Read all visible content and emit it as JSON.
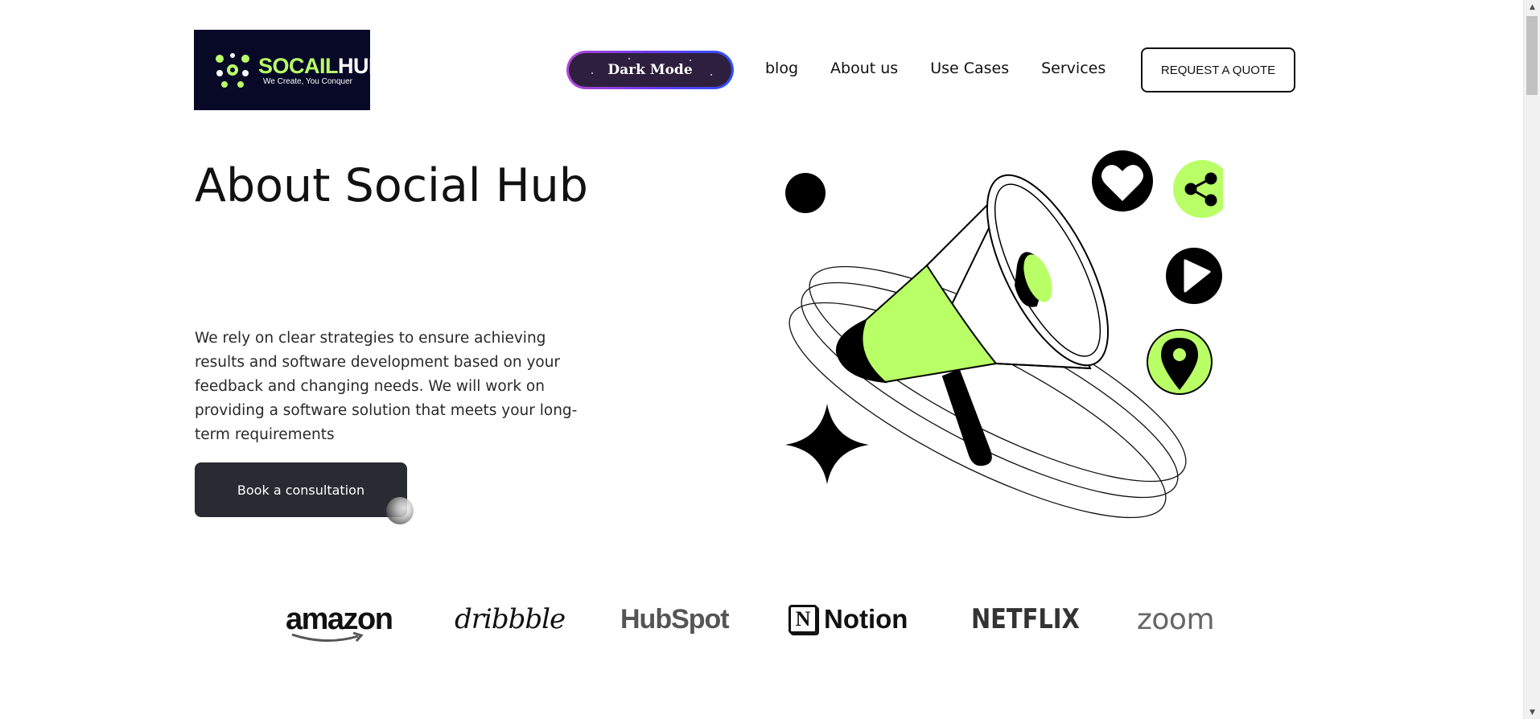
{
  "header": {
    "logo": {
      "name_part1": "SOCAIL",
      "name_part2": "HUB",
      "tagline": "We Create, You Conquer"
    },
    "dark_mode_label": "Dark Mode",
    "nav": [
      {
        "label": "blog"
      },
      {
        "label": "About us"
      },
      {
        "label": "Use Cases"
      },
      {
        "label": "Services"
      }
    ],
    "quote_button": "REQUEST A QUOTE"
  },
  "hero": {
    "title": "About Social Hub",
    "description": "We rely on clear strategies to ensure achieving results and software development based on your feedback and changing needs. We will work on providing a software solution that meets your long-term requirements",
    "cta": "Book a consultation"
  },
  "brands": [
    {
      "name": "amazon"
    },
    {
      "name": "dribbble"
    },
    {
      "name": "HubSpot"
    },
    {
      "name": "Notion",
      "mark": "N"
    },
    {
      "name": "NETFLIX"
    },
    {
      "name": "zoom"
    }
  ],
  "colors": {
    "accent": "#b9ff66",
    "dark": "#191a23",
    "logo_bg": "#070927",
    "button_dark": "#292a32"
  },
  "icons": [
    "heart-icon",
    "share-icon",
    "play-icon",
    "location-pin-icon",
    "megaphone-icon",
    "sparkle-icon"
  ]
}
